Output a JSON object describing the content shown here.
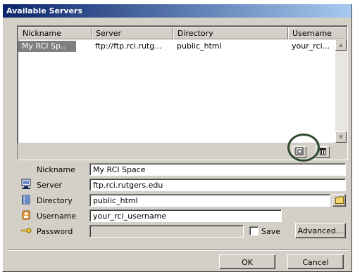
{
  "window": {
    "title": "Available Servers"
  },
  "table": {
    "columns": [
      "Nickname",
      "Server",
      "Directory",
      "Username"
    ],
    "rows": [
      {
        "nickname": "My RCI Sp..",
        "server": "ftp://ftp.rci.rutg...",
        "directory": "public_html",
        "username": "your_rci..."
      }
    ]
  },
  "form": {
    "nickname": {
      "label": "Nickname",
      "value": "My RCI Space"
    },
    "server": {
      "label": "Server",
      "value": "ftp.rci.rutgers.edu"
    },
    "directory": {
      "label": "Directory",
      "value": "public_html"
    },
    "username": {
      "label": "Username",
      "value": "your_rci_username"
    },
    "password": {
      "label": "Password",
      "value": ""
    },
    "save_label": "Save",
    "save_checked": false,
    "advanced_label": "Advanced..."
  },
  "buttons": {
    "ok": "OK",
    "cancel": "Cancel"
  },
  "icons": {
    "server": "server-icon",
    "directory": "folder-book-icon",
    "username": "user-icon",
    "password": "key-icon",
    "browse": "folder-icon",
    "new_server": "new-item-icon",
    "delete": "trash-icon"
  },
  "colors": {
    "title_start": "#0a246a",
    "title_end": "#a6caf0",
    "face": "#d4d0c8",
    "highlight_circle": "#2e4a2e"
  }
}
